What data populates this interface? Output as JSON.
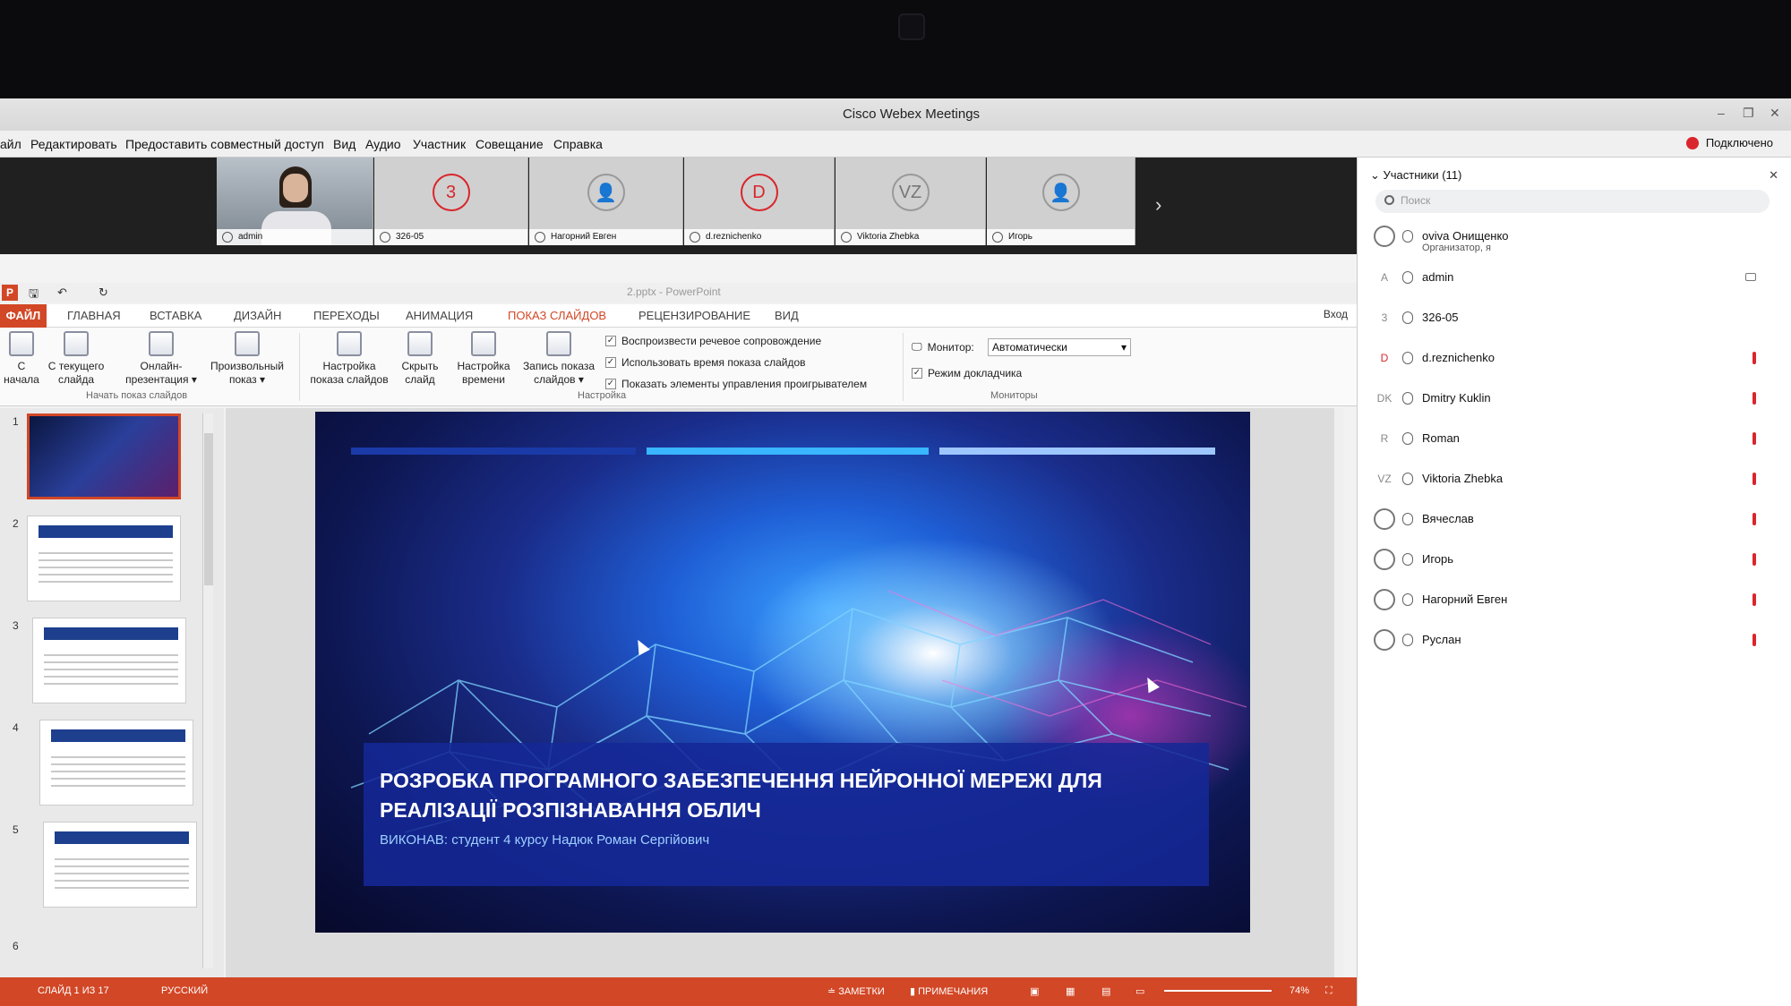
{
  "webex": {
    "title": "Cisco Webex Meetings",
    "menu": [
      "айл",
      "Редактировать",
      "Предоставить совместный доступ",
      "Вид",
      "Аудио",
      "Участник",
      "Совещание",
      "Справка"
    ],
    "connected": "Подключено",
    "window_controls": [
      "–",
      "❐",
      "✕"
    ]
  },
  "strip": {
    "thumbs": [
      {
        "name": "admin",
        "avatar": ""
      },
      {
        "name": "326-05",
        "avatar": "3"
      },
      {
        "name": "Нагорний Евген",
        "avatar": "👤"
      },
      {
        "name": "d.reznichenko",
        "avatar": "D"
      },
      {
        "name": "Viktoria Zhebka",
        "avatar": "VZ"
      },
      {
        "name": "Игорь",
        "avatar": "👤"
      }
    ],
    "next": "›"
  },
  "ppt": {
    "file_name": "2.pptx - PowerPoint",
    "tabs": [
      "ФАЙЛ",
      "ГЛАВНАЯ",
      "ВСТАВКА",
      "ДИЗАЙН",
      "ПЕРЕХОДЫ",
      "АНИМАЦИЯ",
      "ПОКАЗ СЛАЙДОВ",
      "РЕЦЕНЗИРОВАНИЕ",
      "ВИД"
    ],
    "login": "Вход",
    "ribbon": {
      "from_start": "С\nначала",
      "from_current": "С текущего\nслайда",
      "online": "Онлайн-\nпрезентация ▾",
      "custom": "Произвольный\nпоказ ▾",
      "group_start": "Начать показ слайдов",
      "setup": "Настройка\nпоказа слайдов",
      "hide": "Скрыть\nслайд",
      "timing": "Настройка\nвремени",
      "record": "Запись показа\nслайдов ▾",
      "chk1": "Воспроизвести речевое сопровождение",
      "chk2": "Использовать время показа слайдов",
      "chk3": "Показать элементы управления проигрывателем",
      "group_setup": "Настройка",
      "monitor_label": "Монитор:",
      "monitor_value": "Автоматически",
      "presenter_mode": "Режим докладчика",
      "group_monitors": "Мониторы"
    },
    "slide_numbers": [
      "1",
      "2",
      "3",
      "4",
      "5",
      "6"
    ],
    "slide": {
      "title": "РОЗРОБКА ПРОГРАМНОГО ЗАБЕЗПЕЧЕННЯ НЕЙРОННОЇ МЕРЕЖІ ДЛЯ РЕАЛІЗАЦІЇ РОЗПІЗНАВАННЯ ОБЛИЧ",
      "subtitle": "ВИКОНАВ: студент 4 курсу Надюк Роман Сергійович"
    },
    "status": {
      "slide_count": "СЛАЙД 1 ИЗ 17",
      "language": "РУССКИЙ",
      "notes": "≐ ЗАМЕТКИ",
      "comments": "▮ ПРИМЕЧАНИЯ",
      "zoom": "74%"
    }
  },
  "participants": {
    "header": "Участники (11)",
    "search_placeholder": "Поиск",
    "list": [
      {
        "avatar": "",
        "name": "oviva Онищенко",
        "sub": "Организатор, я"
      },
      {
        "avatar": "A",
        "name": "admin",
        "sub": ""
      },
      {
        "avatar": "3",
        "name": "326-05",
        "sub": ""
      },
      {
        "avatar": "D",
        "name": "d.reznichenko",
        "sub": ""
      },
      {
        "avatar": "DK",
        "name": "Dmitry Kuklin",
        "sub": ""
      },
      {
        "avatar": "R",
        "name": "Roman",
        "sub": ""
      },
      {
        "avatar": "VZ",
        "name": "Viktoria Zhebka",
        "sub": ""
      },
      {
        "avatar": "",
        "name": "Вячеслав",
        "sub": ""
      },
      {
        "avatar": "",
        "name": "Игорь",
        "sub": ""
      },
      {
        "avatar": "",
        "name": "Нагорний Евген",
        "sub": ""
      },
      {
        "avatar": "",
        "name": "Руслан",
        "sub": ""
      }
    ]
  },
  "colors": {
    "ppt_accent": "#d24726",
    "webex_red": "#d9262c",
    "slide_box": "#14289a"
  }
}
